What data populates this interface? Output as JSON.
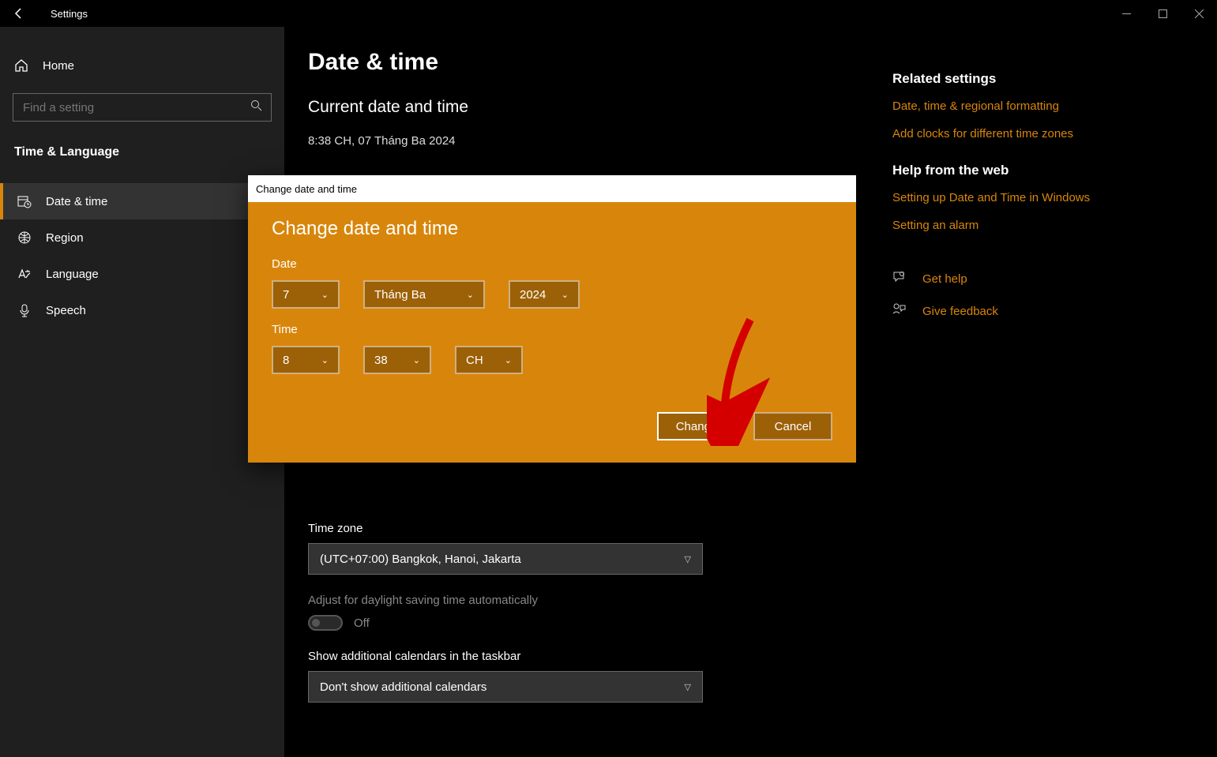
{
  "titlebar": {
    "app_title": "Settings"
  },
  "sidebar": {
    "home": "Home",
    "search_placeholder": "Find a setting",
    "category": "Time & Language",
    "items": [
      {
        "label": "Date & time"
      },
      {
        "label": "Region"
      },
      {
        "label": "Language"
      },
      {
        "label": "Speech"
      }
    ]
  },
  "page": {
    "title": "Date & time",
    "current_section": "Current date and time",
    "current_value": "8:38 CH, 07 Tháng Ba 2024",
    "timezone_label": "Time zone",
    "timezone_value": "(UTC+07:00) Bangkok, Hanoi, Jakarta",
    "dst_label": "Adjust for daylight saving time automatically",
    "dst_value": "Off",
    "additional_cal_label": "Show additional calendars in the taskbar",
    "additional_cal_value": "Don't show additional calendars"
  },
  "right": {
    "related_header": "Related settings",
    "related_links": [
      "Date, time & regional formatting",
      "Add clocks for different time zones"
    ],
    "help_header": "Help from the web",
    "help_links": [
      "Setting up Date and Time in Windows",
      "Setting an alarm"
    ],
    "get_help": "Get help",
    "give_feedback": "Give feedback"
  },
  "dialog": {
    "titlebar": "Change date and time",
    "heading": "Change date and time",
    "date_label": "Date",
    "day": "7",
    "month": "Tháng Ba",
    "year": "2024",
    "time_label": "Time",
    "hour": "8",
    "minute": "38",
    "ampm": "CH",
    "change_btn": "Change",
    "cancel_btn": "Cancel"
  }
}
